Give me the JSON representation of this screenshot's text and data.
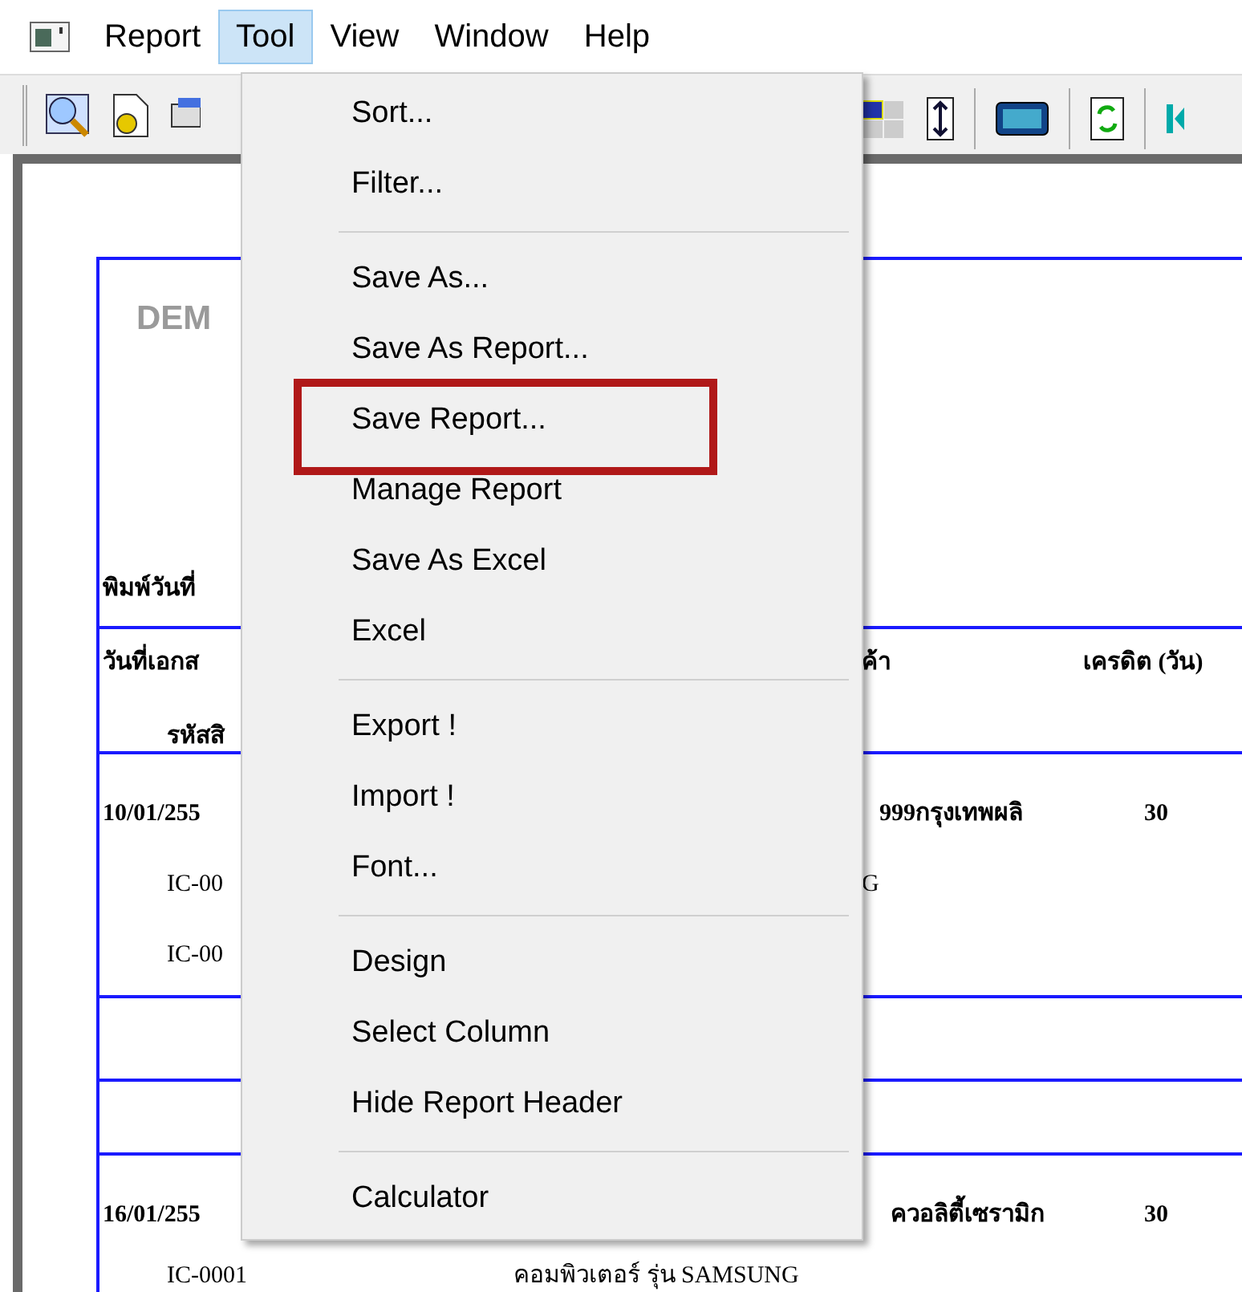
{
  "menubar": [
    {
      "label": "Report",
      "selected": false
    },
    {
      "label": "Tool",
      "selected": true
    },
    {
      "label": "View",
      "selected": false
    },
    {
      "label": "Window",
      "selected": false
    },
    {
      "label": "Help",
      "selected": false
    }
  ],
  "menu": [
    {
      "kind": "item",
      "label": "Sort...",
      "highlighted": false
    },
    {
      "kind": "item",
      "label": "Filter...",
      "highlighted": false
    },
    {
      "kind": "separator"
    },
    {
      "kind": "item",
      "label": "Save As...",
      "highlighted": false
    },
    {
      "kind": "item",
      "label": "Save As Report...",
      "highlighted": false
    },
    {
      "kind": "item",
      "label": "Save Report...",
      "highlighted": true
    },
    {
      "kind": "item",
      "label": "Manage Report",
      "highlighted": false
    },
    {
      "kind": "item",
      "label": "Save As Excel",
      "highlighted": false
    },
    {
      "kind": "item",
      "label": "Excel",
      "highlighted": false
    },
    {
      "kind": "separator"
    },
    {
      "kind": "item",
      "label": "Export !",
      "highlighted": false
    },
    {
      "kind": "item",
      "label": "Import !",
      "highlighted": false
    },
    {
      "kind": "item",
      "label": "Font...",
      "highlighted": false
    },
    {
      "kind": "separator"
    },
    {
      "kind": "item",
      "label": "Design",
      "highlighted": false
    },
    {
      "kind": "item",
      "label": "Select Column",
      "highlighted": false
    },
    {
      "kind": "item",
      "label": "Hide Report Header",
      "highlighted": false
    },
    {
      "kind": "separator"
    },
    {
      "kind": "item",
      "label": "Calculator",
      "highlighted": false
    }
  ],
  "report": {
    "company": "DEM",
    "print_date": "พิมพ์วันที่",
    "header": [
      "วันที่เอกส",
      "รหัสสิ",
      "ค้า",
      "เครดิต (วัน)"
    ],
    "rows": [
      {
        "date": "10/01/255",
        "customer": "999กรุงเทพผลิ",
        "credit": "30",
        "lines": [
          {
            "code": "IC-00",
            "name": "G"
          },
          {
            "code": "IC-00"
          }
        ]
      },
      {
        "date": "16/01/255",
        "customer": "ควอลิตี้เซรามิก",
        "credit": "30",
        "lines": [
          {
            "code": "IC-0001",
            "name": "คอมพิวเตอร์ รุ่น SAMSUNG"
          }
        ]
      }
    ]
  }
}
